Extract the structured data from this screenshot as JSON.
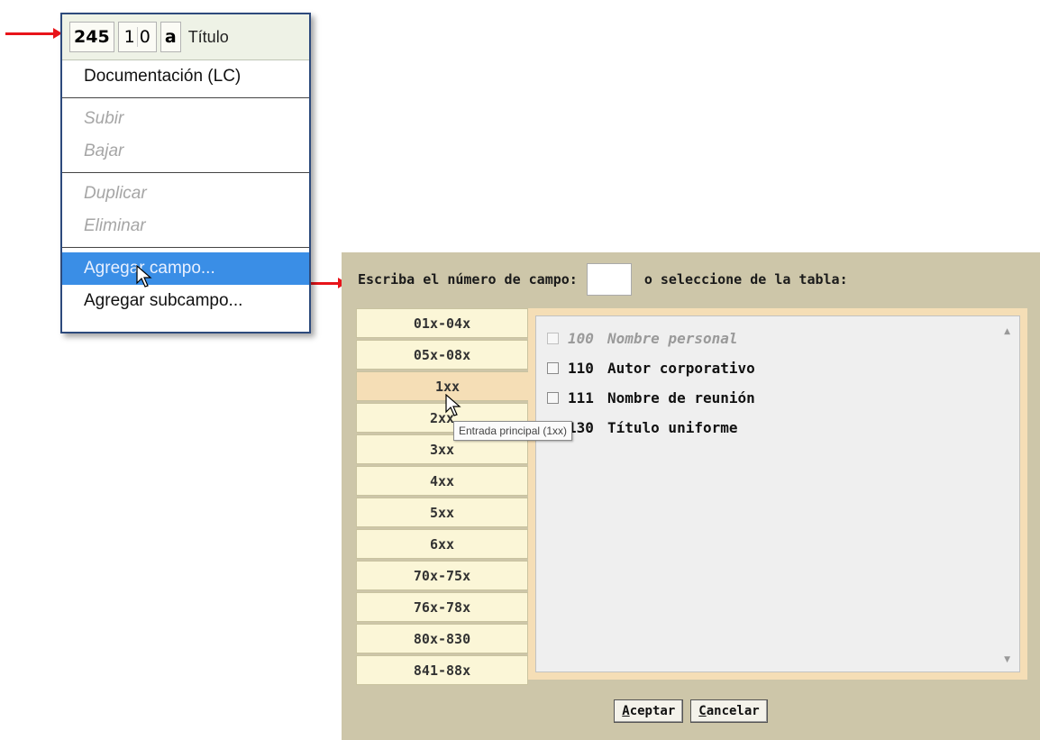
{
  "context_menu": {
    "tag": "245",
    "indicators": [
      "1",
      "0"
    ],
    "subfield": "a",
    "title": "Título",
    "items": [
      {
        "label": "Documentación (LC)",
        "state": "enabled"
      },
      {
        "label": "Subir",
        "state": "disabled"
      },
      {
        "label": "Bajar",
        "state": "disabled"
      },
      {
        "label": "Duplicar",
        "state": "disabled"
      },
      {
        "label": "Eliminar",
        "state": "disabled"
      },
      {
        "label": "Agregar campo...",
        "state": "selected"
      },
      {
        "label": "Agregar subcampo...",
        "state": "enabled"
      }
    ]
  },
  "dialog": {
    "prompt_prefix": "Escriba el número de campo:",
    "field_input_value": "",
    "prompt_suffix": "o seleccione de la tabla:",
    "ranges": [
      "01x-04x",
      "05x-08x",
      "1xx",
      "2xx",
      "3xx",
      "4xx",
      "5xx",
      "6xx",
      "70x-75x",
      "76x-78x",
      "80x-830",
      "841-88x"
    ],
    "active_range": "1xx",
    "fields": [
      {
        "code": "100",
        "label": "Nombre personal",
        "disabled": true
      },
      {
        "code": "110",
        "label": "Autor corporativo",
        "disabled": false
      },
      {
        "code": "111",
        "label": "Nombre de reunión",
        "disabled": false
      },
      {
        "code": "130",
        "label": "Título uniforme",
        "disabled": false
      }
    ],
    "accept_label": "Aceptar",
    "accept_accesskey": "A",
    "cancel_label": "Cancelar",
    "cancel_accesskey": "C"
  },
  "tooltip": "Entrada principal (1xx)",
  "colors": {
    "arrow": "#e8141a",
    "menu_selected": "#3a8ee6",
    "dialog_background": "#cdc6a9",
    "active_tab": "#f5deb6"
  }
}
